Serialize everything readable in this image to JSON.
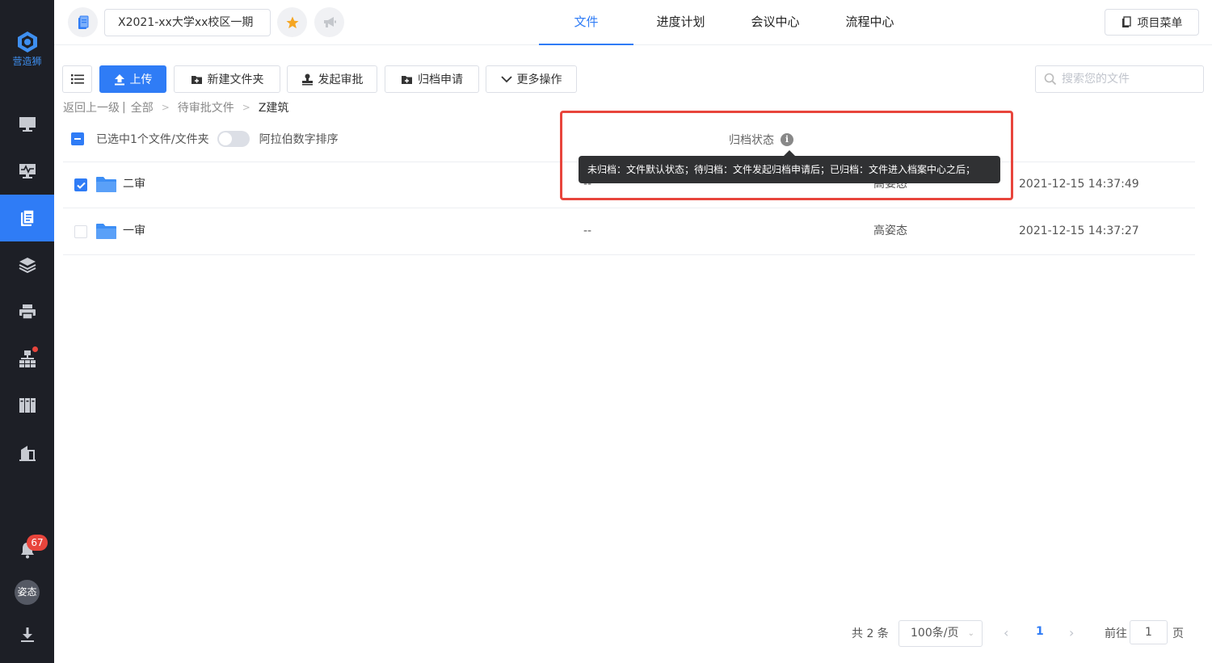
{
  "sidebar": {
    "logo_text": "营造狮",
    "notification_count": "67",
    "avatar_text": "姿态"
  },
  "topbar": {
    "project_name": "X2021-xx大学xx校区一期",
    "tabs": [
      {
        "label": "文件",
        "active": true
      },
      {
        "label": "进度计划",
        "active": false
      },
      {
        "label": "会议中心",
        "active": false
      },
      {
        "label": "流程中心",
        "active": false
      }
    ],
    "menu_label": "项目菜单"
  },
  "toolbar": {
    "upload": "上传",
    "new_folder": "新建文件夹",
    "start_approval": "发起审批",
    "archive_request": "归档申请",
    "more_actions": "更多操作",
    "search_placeholder": "搜索您的文件"
  },
  "breadcrumb": {
    "back": "返回上一级",
    "divider": "|",
    "items": [
      "全部",
      "待审批文件",
      "Z建筑"
    ]
  },
  "selection": {
    "text": "已选中1个文件/文件夹",
    "sort_label": "阿拉伯数字排序"
  },
  "column": {
    "archive_status": "归档状态"
  },
  "tooltip": {
    "text": "未归档：文件默认状态；待归档：文件发起归档申请后；已归档：文件进入档案中心之后；"
  },
  "rows": [
    {
      "name": "二审",
      "status": "--",
      "owner": "高姿态",
      "time": "2021-12-15 14:37:49",
      "checked": true
    },
    {
      "name": "一审",
      "status": "--",
      "owner": "高姿态",
      "time": "2021-12-15 14:37:27",
      "checked": false
    }
  ],
  "pagination": {
    "total": "共 2 条",
    "page_size": "100条/页",
    "current_page": "1",
    "goto_label": "前往",
    "goto_value": "1",
    "page_suffix": "页"
  },
  "colors": {
    "primary": "#2f7cf6",
    "sidebar_bg": "#1d1f26",
    "highlight": "#e8453c",
    "folder": "#3d8ef5",
    "star": "#f5a623"
  }
}
